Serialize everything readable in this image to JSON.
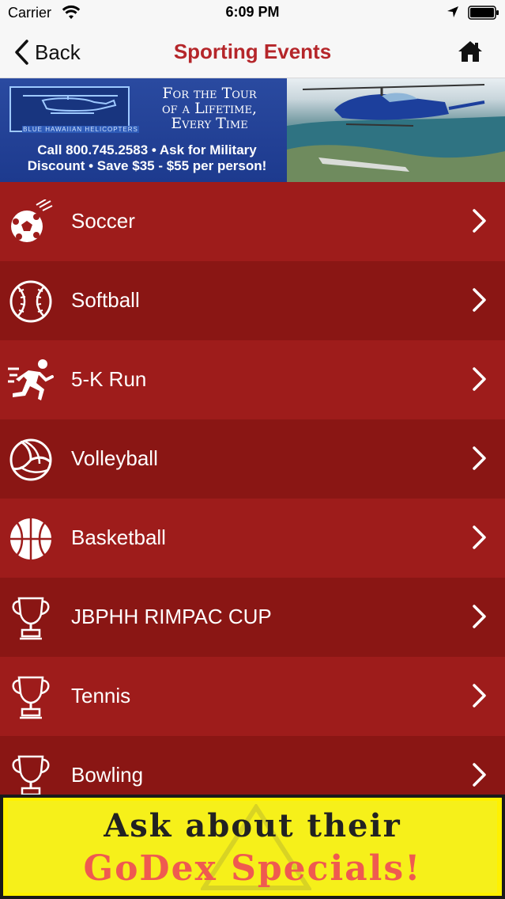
{
  "status_bar": {
    "carrier": "Carrier",
    "time": "6:09 PM"
  },
  "nav": {
    "back_label": "Back",
    "title": "Sporting Events",
    "title_color": "#b5262a"
  },
  "top_ad": {
    "logo_text": "BLUE HAWAIIAN HELICOPTERS",
    "tagline_line1": "For the Tour",
    "tagline_line2": "of a Lifetime,",
    "tagline_line3": "Every Time",
    "promo_line1": "Call 800.745.2583 • Ask for Military",
    "promo_line2": "Discount • Save $35 - $55 per person!"
  },
  "events": [
    {
      "label": "Soccer",
      "icon": "soccer-ball-icon"
    },
    {
      "label": "Softball",
      "icon": "softball-icon"
    },
    {
      "label": "5-K Run",
      "icon": "runner-icon"
    },
    {
      "label": "Volleyball",
      "icon": "volleyball-icon"
    },
    {
      "label": "Basketball",
      "icon": "basketball-icon"
    },
    {
      "label": "JBPHH RIMPAC CUP",
      "icon": "trophy-icon"
    },
    {
      "label": "Tennis",
      "icon": "trophy-icon"
    },
    {
      "label": "Bowling",
      "icon": "trophy-icon"
    }
  ],
  "bottom_ad": {
    "line1": "Ask about their",
    "line2": "GoDex Specials!"
  },
  "colors": {
    "row_odd": "#9e1c1b",
    "row_even": "#8a1614",
    "ad_yellow": "#fff100",
    "ad_red_text": "#ef5a50"
  }
}
